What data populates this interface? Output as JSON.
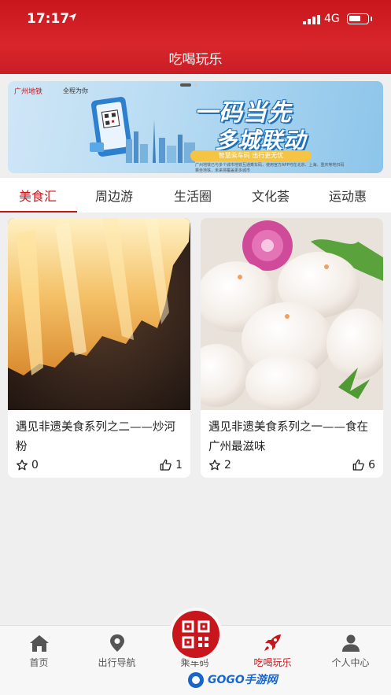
{
  "status_bar": {
    "time": "17:17",
    "network": "4G"
  },
  "header": {
    "title": "吃喝玩乐"
  },
  "banner": {
    "logo": "广州地铁",
    "slogan_small": "全程为你",
    "headline_1": "一码当先",
    "headline_2": "多城联动",
    "pill": "智慧乘车码  出行更无忧",
    "desc": "广州地铁已与多个城市地铁互通乘车码，使用官方APP可在北京、上海、重庆等地扫码乘坐地铁，未来将覆盖更多城市"
  },
  "tabs": [
    {
      "label": "美食汇",
      "active": true
    },
    {
      "label": "周边游",
      "active": false
    },
    {
      "label": "生活圈",
      "active": false
    },
    {
      "label": "文化荟",
      "active": false
    },
    {
      "label": "运动惠",
      "active": false
    }
  ],
  "cards": [
    {
      "title": "遇见非遗美食系列之二——炒河粉",
      "favorites": "0",
      "likes": "1"
    },
    {
      "title": "遇见非遗美食系列之一——食在广州最滋味",
      "favorites": "2",
      "likes": "6"
    }
  ],
  "tabbar": [
    {
      "label": "首页",
      "icon": "home-icon"
    },
    {
      "label": "出行导航",
      "icon": "location-pin-icon"
    },
    {
      "label": "乘车码",
      "icon": "qr-code-icon"
    },
    {
      "label": "吃喝玩乐",
      "icon": "rocket-icon"
    },
    {
      "label": "个人中心",
      "icon": "person-icon"
    }
  ],
  "watermark": "GOGO手游网",
  "colors": {
    "brand_red": "#c8161d",
    "tab_inactive": "#555555"
  }
}
